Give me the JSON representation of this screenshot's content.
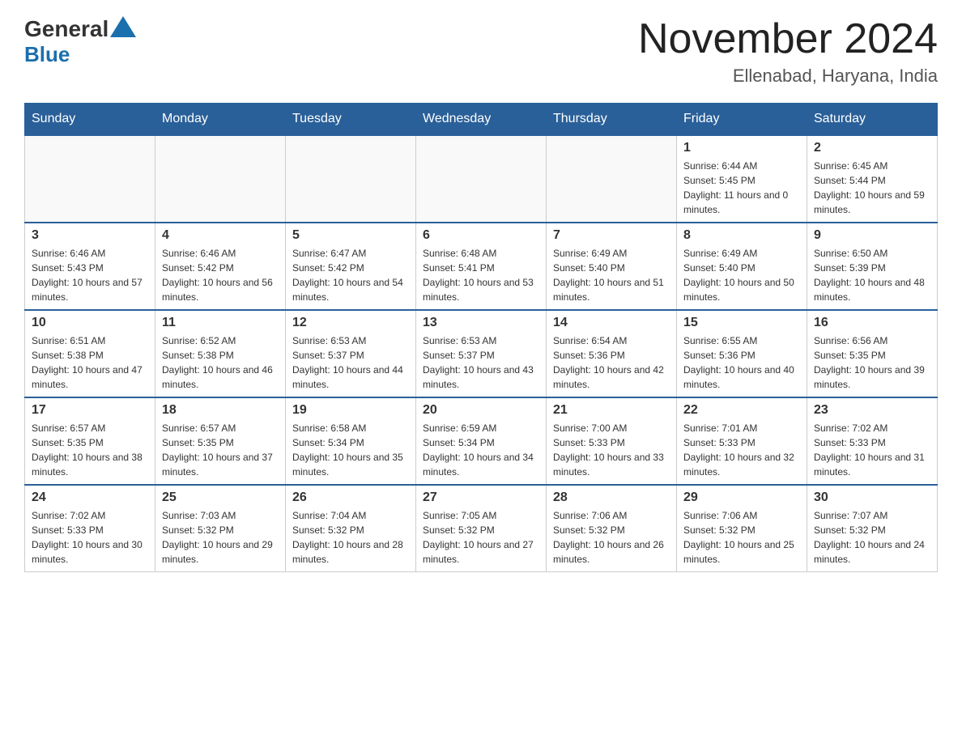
{
  "header": {
    "logo_general": "General",
    "logo_blue": "Blue",
    "month_title": "November 2024",
    "location": "Ellenabad, Haryana, India"
  },
  "weekdays": [
    "Sunday",
    "Monday",
    "Tuesday",
    "Wednesday",
    "Thursday",
    "Friday",
    "Saturday"
  ],
  "weeks": [
    [
      {
        "day": "",
        "info": ""
      },
      {
        "day": "",
        "info": ""
      },
      {
        "day": "",
        "info": ""
      },
      {
        "day": "",
        "info": ""
      },
      {
        "day": "",
        "info": ""
      },
      {
        "day": "1",
        "info": "Sunrise: 6:44 AM\nSunset: 5:45 PM\nDaylight: 11 hours and 0 minutes."
      },
      {
        "day": "2",
        "info": "Sunrise: 6:45 AM\nSunset: 5:44 PM\nDaylight: 10 hours and 59 minutes."
      }
    ],
    [
      {
        "day": "3",
        "info": "Sunrise: 6:46 AM\nSunset: 5:43 PM\nDaylight: 10 hours and 57 minutes."
      },
      {
        "day": "4",
        "info": "Sunrise: 6:46 AM\nSunset: 5:42 PM\nDaylight: 10 hours and 56 minutes."
      },
      {
        "day": "5",
        "info": "Sunrise: 6:47 AM\nSunset: 5:42 PM\nDaylight: 10 hours and 54 minutes."
      },
      {
        "day": "6",
        "info": "Sunrise: 6:48 AM\nSunset: 5:41 PM\nDaylight: 10 hours and 53 minutes."
      },
      {
        "day": "7",
        "info": "Sunrise: 6:49 AM\nSunset: 5:40 PM\nDaylight: 10 hours and 51 minutes."
      },
      {
        "day": "8",
        "info": "Sunrise: 6:49 AM\nSunset: 5:40 PM\nDaylight: 10 hours and 50 minutes."
      },
      {
        "day": "9",
        "info": "Sunrise: 6:50 AM\nSunset: 5:39 PM\nDaylight: 10 hours and 48 minutes."
      }
    ],
    [
      {
        "day": "10",
        "info": "Sunrise: 6:51 AM\nSunset: 5:38 PM\nDaylight: 10 hours and 47 minutes."
      },
      {
        "day": "11",
        "info": "Sunrise: 6:52 AM\nSunset: 5:38 PM\nDaylight: 10 hours and 46 minutes."
      },
      {
        "day": "12",
        "info": "Sunrise: 6:53 AM\nSunset: 5:37 PM\nDaylight: 10 hours and 44 minutes."
      },
      {
        "day": "13",
        "info": "Sunrise: 6:53 AM\nSunset: 5:37 PM\nDaylight: 10 hours and 43 minutes."
      },
      {
        "day": "14",
        "info": "Sunrise: 6:54 AM\nSunset: 5:36 PM\nDaylight: 10 hours and 42 minutes."
      },
      {
        "day": "15",
        "info": "Sunrise: 6:55 AM\nSunset: 5:36 PM\nDaylight: 10 hours and 40 minutes."
      },
      {
        "day": "16",
        "info": "Sunrise: 6:56 AM\nSunset: 5:35 PM\nDaylight: 10 hours and 39 minutes."
      }
    ],
    [
      {
        "day": "17",
        "info": "Sunrise: 6:57 AM\nSunset: 5:35 PM\nDaylight: 10 hours and 38 minutes."
      },
      {
        "day": "18",
        "info": "Sunrise: 6:57 AM\nSunset: 5:35 PM\nDaylight: 10 hours and 37 minutes."
      },
      {
        "day": "19",
        "info": "Sunrise: 6:58 AM\nSunset: 5:34 PM\nDaylight: 10 hours and 35 minutes."
      },
      {
        "day": "20",
        "info": "Sunrise: 6:59 AM\nSunset: 5:34 PM\nDaylight: 10 hours and 34 minutes."
      },
      {
        "day": "21",
        "info": "Sunrise: 7:00 AM\nSunset: 5:33 PM\nDaylight: 10 hours and 33 minutes."
      },
      {
        "day": "22",
        "info": "Sunrise: 7:01 AM\nSunset: 5:33 PM\nDaylight: 10 hours and 32 minutes."
      },
      {
        "day": "23",
        "info": "Sunrise: 7:02 AM\nSunset: 5:33 PM\nDaylight: 10 hours and 31 minutes."
      }
    ],
    [
      {
        "day": "24",
        "info": "Sunrise: 7:02 AM\nSunset: 5:33 PM\nDaylight: 10 hours and 30 minutes."
      },
      {
        "day": "25",
        "info": "Sunrise: 7:03 AM\nSunset: 5:32 PM\nDaylight: 10 hours and 29 minutes."
      },
      {
        "day": "26",
        "info": "Sunrise: 7:04 AM\nSunset: 5:32 PM\nDaylight: 10 hours and 28 minutes."
      },
      {
        "day": "27",
        "info": "Sunrise: 7:05 AM\nSunset: 5:32 PM\nDaylight: 10 hours and 27 minutes."
      },
      {
        "day": "28",
        "info": "Sunrise: 7:06 AM\nSunset: 5:32 PM\nDaylight: 10 hours and 26 minutes."
      },
      {
        "day": "29",
        "info": "Sunrise: 7:06 AM\nSunset: 5:32 PM\nDaylight: 10 hours and 25 minutes."
      },
      {
        "day": "30",
        "info": "Sunrise: 7:07 AM\nSunset: 5:32 PM\nDaylight: 10 hours and 24 minutes."
      }
    ]
  ]
}
